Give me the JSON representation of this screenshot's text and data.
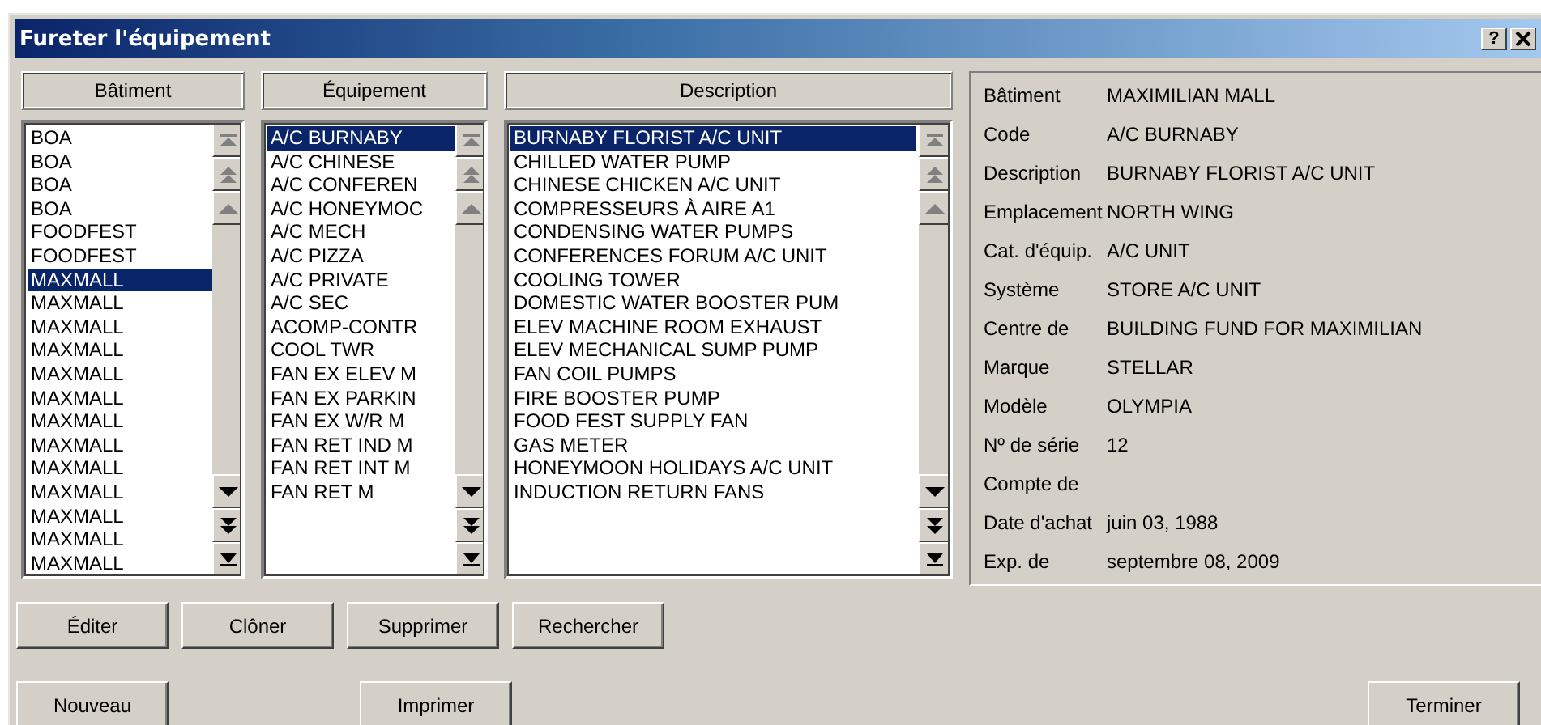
{
  "window": {
    "title": "Fureter l'équipement",
    "help_button": "?"
  },
  "lists": [
    {
      "header": "Bâtiment",
      "items": [
        {
          "text": "BOA",
          "selected": false
        },
        {
          "text": "BOA",
          "selected": false
        },
        {
          "text": "BOA",
          "selected": false
        },
        {
          "text": "BOA",
          "selected": false
        },
        {
          "text": "FOODFEST",
          "selected": false
        },
        {
          "text": "FOODFEST",
          "selected": false
        },
        {
          "text": "MAXMALL",
          "selected": true
        },
        {
          "text": "MAXMALL",
          "selected": false
        },
        {
          "text": "MAXMALL",
          "selected": false
        },
        {
          "text": "MAXMALL",
          "selected": false
        },
        {
          "text": "MAXMALL",
          "selected": false
        },
        {
          "text": "MAXMALL",
          "selected": false
        },
        {
          "text": "MAXMALL",
          "selected": false
        },
        {
          "text": "MAXMALL",
          "selected": false
        },
        {
          "text": "MAXMALL",
          "selected": false
        },
        {
          "text": "MAXMALL",
          "selected": false
        },
        {
          "text": "MAXMALL",
          "selected": false
        },
        {
          "text": "MAXMALL",
          "selected": false
        },
        {
          "text": "MAXMALL",
          "selected": false
        }
      ]
    },
    {
      "header": "Équipement",
      "items": [
        {
          "text": "A/C BURNABY",
          "selected": true
        },
        {
          "text": "A/C CHINESE",
          "selected": false
        },
        {
          "text": "A/C CONFEREN",
          "selected": false
        },
        {
          "text": "A/C HONEYMOC",
          "selected": false
        },
        {
          "text": "A/C MECH",
          "selected": false
        },
        {
          "text": "A/C PIZZA",
          "selected": false
        },
        {
          "text": "A/C PRIVATE",
          "selected": false
        },
        {
          "text": "A/C SEC",
          "selected": false
        },
        {
          "text": "ACOMP-CONTR",
          "selected": false
        },
        {
          "text": "COOL TWR",
          "selected": false
        },
        {
          "text": "FAN EX ELEV M",
          "selected": false
        },
        {
          "text": "FAN EX PARKIN",
          "selected": false
        },
        {
          "text": "FAN EX W/R M",
          "selected": false
        },
        {
          "text": "FAN RET IND M",
          "selected": false
        },
        {
          "text": "FAN RET INT M",
          "selected": false
        },
        {
          "text": "FAN RET M",
          "selected": false
        }
      ]
    },
    {
      "header": "Description",
      "items": [
        {
          "text": "BURNABY FLORIST A/C UNIT",
          "selected": true
        },
        {
          "text": "CHILLED WATER PUMP",
          "selected": false
        },
        {
          "text": "CHINESE CHICKEN A/C UNIT",
          "selected": false
        },
        {
          "text": "COMPRESSEURS À AIRE A1",
          "selected": false
        },
        {
          "text": "CONDENSING WATER PUMPS",
          "selected": false
        },
        {
          "text": "CONFERENCES FORUM A/C UNIT",
          "selected": false
        },
        {
          "text": "COOLING TOWER",
          "selected": false
        },
        {
          "text": "DOMESTIC WATER BOOSTER PUM",
          "selected": false
        },
        {
          "text": "ELEV MACHINE ROOM EXHAUST",
          "selected": false
        },
        {
          "text": "ELEV MECHANICAL SUMP PUMP",
          "selected": false
        },
        {
          "text": "FAN COIL PUMPS",
          "selected": false
        },
        {
          "text": "FIRE BOOSTER PUMP",
          "selected": false
        },
        {
          "text": "FOOD FEST SUPPLY FAN",
          "selected": false
        },
        {
          "text": "GAS METER",
          "selected": false
        },
        {
          "text": "HONEYMOON HOLIDAYS A/C UNIT",
          "selected": false
        },
        {
          "text": "INDUCTION RETURN FANS",
          "selected": false
        }
      ]
    }
  ],
  "details": [
    {
      "label": "Bâtiment",
      "value": "MAXIMILIAN MALL"
    },
    {
      "label": "Code",
      "value": "A/C BURNABY"
    },
    {
      "label": "Description",
      "value": "BURNABY FLORIST A/C UNIT"
    },
    {
      "label": "Emplacement",
      "value": "NORTH WING"
    },
    {
      "label": "Cat. d'équip.",
      "value": "A/C UNIT"
    },
    {
      "label": "Système",
      "value": "STORE A/C UNIT"
    },
    {
      "label": "Centre de",
      "value": "BUILDING FUND FOR MAXIMILIAN"
    },
    {
      "label": "Marque",
      "value": "STELLAR"
    },
    {
      "label": "Modèle",
      "value": "OLYMPIA"
    },
    {
      "label": "Nº de série",
      "value": "12"
    },
    {
      "label": "Compte de"
    },
    {
      "label": "Date d'achat",
      "value": "juin 03, 1988"
    },
    {
      "label": "Exp. de",
      "value": "septembre 08, 2009"
    }
  ],
  "button_rows": [
    [
      "Éditer",
      "Clôner",
      "Supprimer",
      "Rechercher"
    ],
    [
      "Nouveau",
      "Imprimer",
      "Terminer"
    ]
  ]
}
